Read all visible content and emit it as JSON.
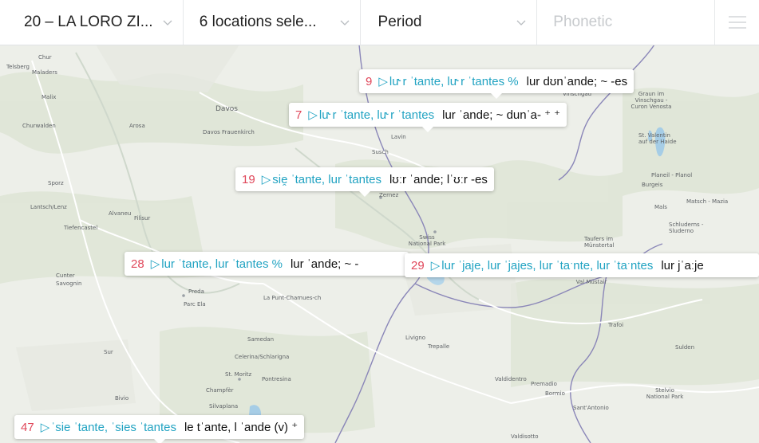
{
  "filters": {
    "questionnaire": "20 – LA LORO ZI...",
    "locations": "6 locations sele...",
    "period": "Period",
    "phonetic_placeholder": "Phonetic"
  },
  "icons": {
    "chevron": "chevron-down-icon",
    "menu": "hamburger-menu-icon",
    "play": "play-icon"
  },
  "colors": {
    "number": "#e0475a",
    "transcription": "#21a3c2",
    "border": "#8a86b8"
  },
  "callouts": [
    {
      "num": "9",
      "play": "▷",
      "trans": "lu˞r ˈtante, lu˞r ˈtantes %",
      "alt": "lur dʊnˈande; ~ -es"
    },
    {
      "num": "7",
      "play": "▷",
      "trans": "lu˞r ˈtante, lu˞r ˈtantes",
      "alt": "lur ˈande; ~ dunˈa- ⁺ ⁺"
    },
    {
      "num": "19",
      "play": "▷",
      "trans": "sie̯ ˈtante, lur ˈtantes",
      "alt": "lʊːr ˈande; lˈʊːr -es"
    },
    {
      "num": "28",
      "play": "▷",
      "trans": "lur ˈtante, lur ˈtantes %",
      "alt": "lur ˈande; ~ -"
    },
    {
      "num": "29",
      "play": "▷",
      "trans": "lur ˈjaje, lur ˈjajes, lur ˈtaˑnte, lur ˈtaˑntes",
      "alt": "lur jˈaːje"
    },
    {
      "num": "47",
      "play": "▷",
      "trans": "ˈsie ˈtante, ˈsies ˈtantes",
      "alt": "le tˈante, l ˈande (v) ⁺"
    }
  ],
  "places": [
    "Chur",
    "Telsberg",
    "Maladers",
    "Malix",
    "Churwalden",
    "Arosa",
    "Davos",
    "Davos Frauenkirch",
    "Sporz",
    "Lantsch/Lenz",
    "Alvaneu",
    "Filisur",
    "Tiefencastel",
    "Cunter",
    "Savognin",
    "Preda",
    "Parc Ela",
    "La Punt-Chamues-ch",
    "Samedan",
    "Celerina/Schlarigna",
    "St. Moritz",
    "Pontresina",
    "Champfèr",
    "Silvaplana",
    "Sur",
    "Bivio",
    "Susch",
    "Lavin",
    "Zernez",
    "Swiss National Park",
    "Livigno",
    "Trepalle",
    "Valdidentro",
    "Premadio",
    "Bormio",
    "Sant'Antonio",
    "Valdisotto",
    "Stelvio National Park",
    "Sulden",
    "Trafoi",
    "Taufers im Münstertal",
    "Santa Maria Val Müstair",
    "Schluderns - Sluderno",
    "Mals",
    "Matsch - Mazia",
    "Planeil - Planol",
    "Burgeis",
    "St. Valentin auf der Haide",
    "Graun im Vinschgau - Curon Venosta",
    "Vinschgau"
  ]
}
